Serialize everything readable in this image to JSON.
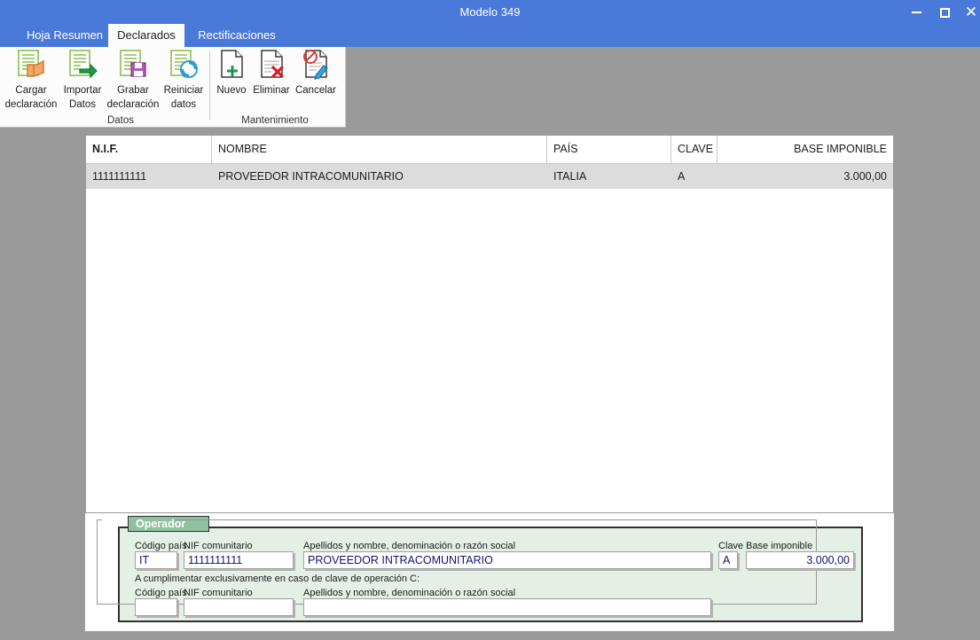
{
  "window": {
    "title": "Modelo 349",
    "minimize": "minimize-icon",
    "maximize": "maximize-icon",
    "close": "✕"
  },
  "tabs": [
    {
      "label": "Hoja Resumen",
      "active": false
    },
    {
      "label": "Declarados",
      "active": true
    },
    {
      "label": "Rectificaciones",
      "active": false
    }
  ],
  "ribbon": {
    "groups": [
      {
        "label": "Datos"
      },
      {
        "label": "Mantenimiento"
      }
    ],
    "buttons": [
      {
        "id": "cargar",
        "line1": "Cargar",
        "line2": "declaración",
        "icon": "load-document-icon"
      },
      {
        "id": "importar",
        "line1": "Importar",
        "line2": "Datos",
        "icon": "import-data-icon"
      },
      {
        "id": "grabar",
        "line1": "Grabar",
        "line2": "declaración",
        "icon": "save-document-icon"
      },
      {
        "id": "reiniciar",
        "line1": "Reiniciar",
        "line2": "datos",
        "icon": "refresh-document-icon"
      },
      {
        "id": "nuevo",
        "line1": "Nuevo",
        "line2": "",
        "icon": "new-document-icon"
      },
      {
        "id": "eliminar",
        "line1": "Eliminar",
        "line2": "",
        "icon": "delete-document-icon"
      },
      {
        "id": "cancelar",
        "line1": "Cancelar",
        "line2": "",
        "icon": "cancel-edit-icon"
      }
    ]
  },
  "grid": {
    "columns": [
      "N.I.F.",
      "NOMBRE",
      "PAÍS",
      "CLAVE",
      "BASE IMPONIBLE"
    ],
    "rows": [
      {
        "nif": "1111111111",
        "nombre": "PROVEEDOR INTRACOMUNITARIO",
        "pais": "ITALIA",
        "clave": "A",
        "base": "3.000,00"
      }
    ]
  },
  "form": {
    "group_title": "Operador",
    "note": "A cumplimentar exclusivamente en caso de clave de operación C:",
    "labels": {
      "codigo_pais": "Código país",
      "nif_comunitario": "NIF comunitario",
      "apellidos": "Apellidos y nombre, denominación o razón social",
      "clave": "Clave",
      "base_imponible": "Base imponible"
    },
    "row1": {
      "codigo_pais": "IT",
      "nif_comunitario": "1111111111",
      "apellidos": "PROVEEDOR INTRACOMUNITARIO",
      "clave": "A",
      "base_imponible": "3.000,00"
    },
    "row2": {
      "codigo_pais": "",
      "nif_comunitario": "",
      "apellidos": ""
    }
  },
  "colors": {
    "titlebar": "#4a7ad9",
    "app_background": "#9a9a9a",
    "group_fill": "#e4efe6",
    "group_tab": "#8fc0a0",
    "row_selected": "#dcdcdc",
    "input_text": "#12127a"
  }
}
